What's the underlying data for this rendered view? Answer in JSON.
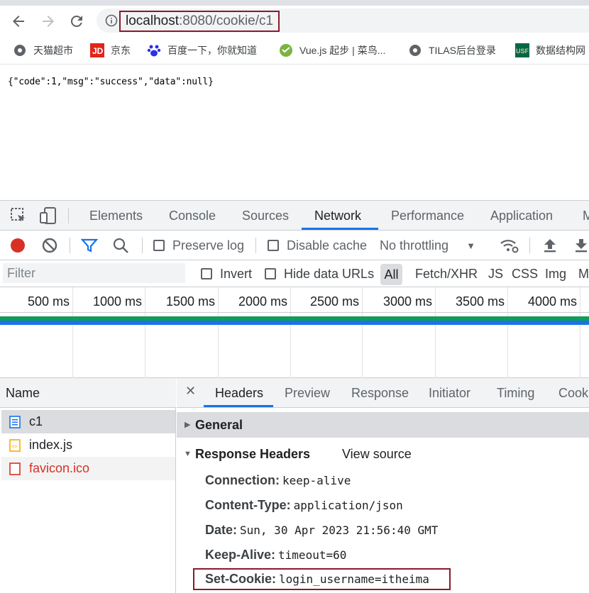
{
  "browser": {
    "url_host": "localhost",
    "url_rest": ":8080/cookie/c1",
    "bookmarks": [
      {
        "label": "天猫超市",
        "icon": "globe-icon"
      },
      {
        "label": "京东",
        "icon": "jd-icon"
      },
      {
        "label": "百度一下，你就知道",
        "icon": "baidu-icon"
      },
      {
        "label": "Vue.js 起步 | 菜鸟...",
        "icon": "runoob-icon"
      },
      {
        "label": "TILAS后台登录",
        "icon": "globe-icon"
      },
      {
        "label": "数据结构网",
        "icon": "usf-icon",
        "icon_text": "USF"
      }
    ]
  },
  "page": {
    "body_text": "{\"code\":1,\"msg\":\"success\",\"data\":null}"
  },
  "devtools": {
    "tabs": [
      "Elements",
      "Console",
      "Sources",
      "Network",
      "Performance",
      "Application",
      "M"
    ],
    "active_tab": "Network",
    "toolbar": {
      "preserve_log": "Preserve log",
      "disable_cache": "Disable cache",
      "throttling": "No throttling"
    },
    "filter": {
      "placeholder": "Filter",
      "invert": "Invert",
      "hide_data_urls": "Hide data URLs",
      "types": [
        "All",
        "Fetch/XHR",
        "JS",
        "CSS",
        "Img",
        "M"
      ]
    },
    "timeline": {
      "ticks": [
        "500 ms",
        "1000 ms",
        "1500 ms",
        "2000 ms",
        "2500 ms",
        "3000 ms",
        "3500 ms",
        "4000 ms"
      ]
    },
    "requests": {
      "header": "Name",
      "items": [
        {
          "name": "c1",
          "type": "document",
          "selected": true
        },
        {
          "name": "index.js",
          "type": "script"
        },
        {
          "name": "favicon.ico",
          "type": "error"
        }
      ]
    },
    "details": {
      "tabs": [
        "Headers",
        "Preview",
        "Response",
        "Initiator",
        "Timing",
        "Cook"
      ],
      "active_tab": "Headers",
      "general_label": "General",
      "response_headers_label": "Response Headers",
      "view_source": "View source",
      "headers": [
        {
          "name": "Connection:",
          "value": "keep-alive"
        },
        {
          "name": "Content-Type:",
          "value": "application/json"
        },
        {
          "name": "Date:",
          "value": "Sun, 30 Apr 2023 21:56:40 GMT"
        },
        {
          "name": "Keep-Alive:",
          "value": "timeout=60"
        },
        {
          "name": "Set-Cookie:",
          "value": "login_username=itheima"
        }
      ]
    }
  },
  "colors": {
    "highlight_box": "#8b1a2b",
    "accent": "#1a73e8",
    "record": "#d93025"
  }
}
